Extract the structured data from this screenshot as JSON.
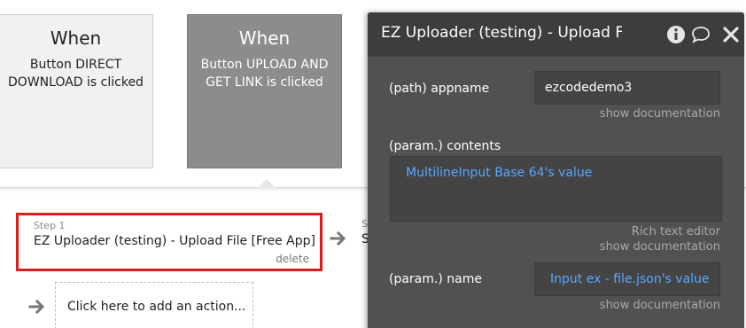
{
  "events": [
    {
      "title": "When",
      "description": "Button DIRECT DOWNLOAD is clicked"
    },
    {
      "title": "When",
      "description": "Button UPLOAD AND GET LINK is clicked"
    }
  ],
  "workflow": {
    "step": {
      "label": "Step 1",
      "title": "EZ Uploader (testing) - Upload File [Free App]",
      "delete_label": "delete"
    },
    "next_step_peek": {
      "label": "S",
      "title": "S"
    },
    "add_action_label": "Click here to add an action..."
  },
  "panel": {
    "title": "EZ Uploader (testing) - Upload File",
    "fields": [
      {
        "label": "(path) appname",
        "value": "ezcodedemo3",
        "doc_label": "show documentation"
      },
      {
        "label": "(param.) contents",
        "value": "MultilineInput Base 64's value",
        "rich_text_label": "Rich text editor",
        "doc_label": "show documentation"
      },
      {
        "label": "(param.) name",
        "value": "Input ex - file.json's value",
        "doc_label": "show documentation"
      }
    ]
  },
  "icons": {
    "info": "info-icon",
    "comment": "comment-icon",
    "close": "close-icon",
    "arrow": "arrow-right-icon"
  },
  "colors": {
    "highlight_border": "#e01b1b",
    "panel_bg": "#515151",
    "panel_header_bg": "#3d3d3d",
    "dynamic_value": "#5aa6ff",
    "selected_event_bg": "#8c8c8c"
  }
}
